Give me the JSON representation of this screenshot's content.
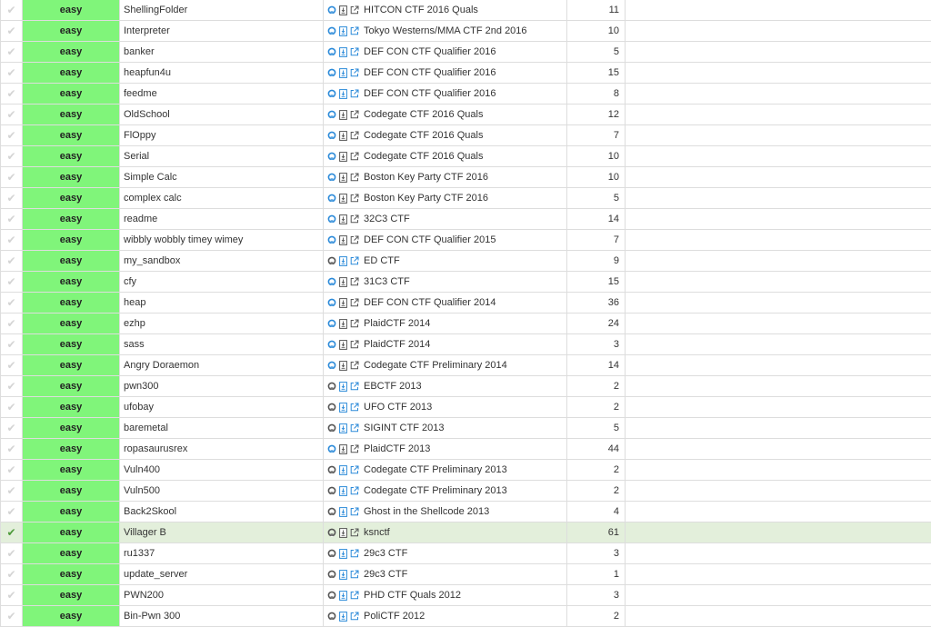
{
  "colors": {
    "easy_bg": "#80f57a",
    "selected_row": "#e3efdb",
    "link_blue": "#2b8ad9",
    "icon_gray": "#555555"
  },
  "rows": [
    {
      "done": false,
      "difficulty": "easy",
      "name": "ShellingFolder",
      "event": "HITCON CTF 2016 Quals",
      "count": "11",
      "github_icon": "blue",
      "doc_icon": "gray"
    },
    {
      "done": false,
      "difficulty": "easy",
      "name": "Interpreter",
      "event": "Tokyo Westerns/MMA CTF 2nd 2016",
      "count": "10",
      "github_icon": "blue",
      "doc_icon": "blue"
    },
    {
      "done": false,
      "difficulty": "easy",
      "name": "banker",
      "event": "DEF CON CTF Qualifier 2016",
      "count": "5",
      "github_icon": "blue",
      "doc_icon": "blue"
    },
    {
      "done": false,
      "difficulty": "easy",
      "name": "heapfun4u",
      "event": "DEF CON CTF Qualifier 2016",
      "count": "15",
      "github_icon": "blue",
      "doc_icon": "blue"
    },
    {
      "done": false,
      "difficulty": "easy",
      "name": "feedme",
      "event": "DEF CON CTF Qualifier 2016",
      "count": "8",
      "github_icon": "blue",
      "doc_icon": "blue"
    },
    {
      "done": false,
      "difficulty": "easy",
      "name": "OldSchool",
      "event": "Codegate CTF 2016 Quals",
      "count": "12",
      "github_icon": "blue",
      "doc_icon": "gray"
    },
    {
      "done": false,
      "difficulty": "easy",
      "name": "FlOppy",
      "event": "Codegate CTF 2016 Quals",
      "count": "7",
      "github_icon": "blue",
      "doc_icon": "gray"
    },
    {
      "done": false,
      "difficulty": "easy",
      "name": "Serial",
      "event": "Codegate CTF 2016 Quals",
      "count": "10",
      "github_icon": "blue",
      "doc_icon": "gray"
    },
    {
      "done": false,
      "difficulty": "easy",
      "name": "Simple Calc",
      "event": "Boston Key Party CTF 2016",
      "count": "10",
      "github_icon": "blue",
      "doc_icon": "gray"
    },
    {
      "done": false,
      "difficulty": "easy",
      "name": "complex calc",
      "event": "Boston Key Party CTF 2016",
      "count": "5",
      "github_icon": "blue",
      "doc_icon": "gray"
    },
    {
      "done": false,
      "difficulty": "easy",
      "name": "readme",
      "event": "32C3 CTF",
      "count": "14",
      "github_icon": "blue",
      "doc_icon": "gray"
    },
    {
      "done": false,
      "difficulty": "easy",
      "name": "wibbly wobbly timey wimey",
      "event": "DEF CON CTF Qualifier 2015",
      "count": "7",
      "github_icon": "blue",
      "doc_icon": "gray"
    },
    {
      "done": false,
      "difficulty": "easy",
      "name": "my_sandbox",
      "event": "ED CTF",
      "count": "9",
      "github_icon": "gray",
      "doc_icon": "blue"
    },
    {
      "done": false,
      "difficulty": "easy",
      "name": "cfy",
      "event": "31C3 CTF",
      "count": "15",
      "github_icon": "blue",
      "doc_icon": "gray"
    },
    {
      "done": false,
      "difficulty": "easy",
      "name": "heap",
      "event": "DEF CON CTF Qualifier 2014",
      "count": "36",
      "github_icon": "blue",
      "doc_icon": "gray"
    },
    {
      "done": false,
      "difficulty": "easy",
      "name": "ezhp",
      "event": "PlaidCTF 2014",
      "count": "24",
      "github_icon": "blue",
      "doc_icon": "gray"
    },
    {
      "done": false,
      "difficulty": "easy",
      "name": "sass",
      "event": "PlaidCTF 2014",
      "count": "3",
      "github_icon": "blue",
      "doc_icon": "gray"
    },
    {
      "done": false,
      "difficulty": "easy",
      "name": "Angry Doraemon",
      "event": "Codegate CTF Preliminary 2014",
      "count": "14",
      "github_icon": "blue",
      "doc_icon": "gray"
    },
    {
      "done": false,
      "difficulty": "easy",
      "name": "pwn300",
      "event": "EBCTF 2013",
      "count": "2",
      "github_icon": "gray",
      "doc_icon": "blue"
    },
    {
      "done": false,
      "difficulty": "easy",
      "name": "ufobay",
      "event": "UFO CTF 2013",
      "count": "2",
      "github_icon": "gray",
      "doc_icon": "blue"
    },
    {
      "done": false,
      "difficulty": "easy",
      "name": "baremetal",
      "event": "SIGINT CTF 2013",
      "count": "5",
      "github_icon": "gray",
      "doc_icon": "blue"
    },
    {
      "done": false,
      "difficulty": "easy",
      "name": "ropasaurusrex",
      "event": "PlaidCTF 2013",
      "count": "44",
      "github_icon": "blue",
      "doc_icon": "gray"
    },
    {
      "done": false,
      "difficulty": "easy",
      "name": "Vuln400",
      "event": "Codegate CTF Preliminary 2013",
      "count": "2",
      "github_icon": "gray",
      "doc_icon": "blue"
    },
    {
      "done": false,
      "difficulty": "easy",
      "name": "Vuln500",
      "event": "Codegate CTF Preliminary 2013",
      "count": "2",
      "github_icon": "gray",
      "doc_icon": "blue"
    },
    {
      "done": false,
      "difficulty": "easy",
      "name": "Back2Skool",
      "event": "Ghost in the Shellcode 2013",
      "count": "4",
      "github_icon": "gray",
      "doc_icon": "blue"
    },
    {
      "done": true,
      "difficulty": "easy",
      "name": "Villager B",
      "event": "ksnctf",
      "count": "61",
      "github_icon": "gray",
      "doc_icon": "gray"
    },
    {
      "done": false,
      "difficulty": "easy",
      "name": "ru1337",
      "event": "29c3 CTF",
      "count": "3",
      "github_icon": "gray",
      "doc_icon": "blue"
    },
    {
      "done": false,
      "difficulty": "easy",
      "name": "update_server",
      "event": "29c3 CTF",
      "count": "1",
      "github_icon": "gray",
      "doc_icon": "blue"
    },
    {
      "done": false,
      "difficulty": "easy",
      "name": "PWN200",
      "event": "PHD CTF Quals 2012",
      "count": "3",
      "github_icon": "gray",
      "doc_icon": "blue"
    },
    {
      "done": false,
      "difficulty": "easy",
      "name": "Bin-Pwn 300",
      "event": "PoliCTF 2012",
      "count": "2",
      "github_icon": "gray",
      "doc_icon": "blue"
    }
  ]
}
